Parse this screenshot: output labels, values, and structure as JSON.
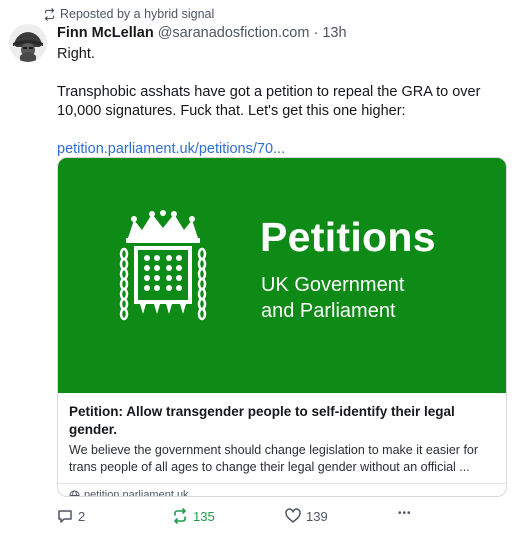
{
  "repost_label": "Reposted by a hybrid signal",
  "author": {
    "name": "Finn McLellan",
    "handle": "@saranadosfiction.com",
    "separator": "·",
    "time": "13h"
  },
  "post": {
    "line1": "Right.",
    "line2": "Transphobic asshats have got a petition to repeal the GRA to over 10,000 signatures. Fuck that. Let's get this one higher:",
    "link": "petition.parliament.uk/petitions/70..."
  },
  "card": {
    "banner_title": "Petitions",
    "banner_sub_line1": "UK Government",
    "banner_sub_line2": "and Parliament",
    "title": "Petition: Allow transgender people to self-identify their legal gender.",
    "description": "We believe the government should change legislation to make it easier for trans people of all ages to change their legal gender without an official ...",
    "domain": "petition.parliament.uk",
    "banner_color": "#0e8b16"
  },
  "actions": {
    "reply_count": "2",
    "repost_count": "135",
    "like_count": "139",
    "more_label": "•••"
  },
  "colors": {
    "link": "#2f6fd4",
    "repost_active": "#1f9e4a"
  }
}
